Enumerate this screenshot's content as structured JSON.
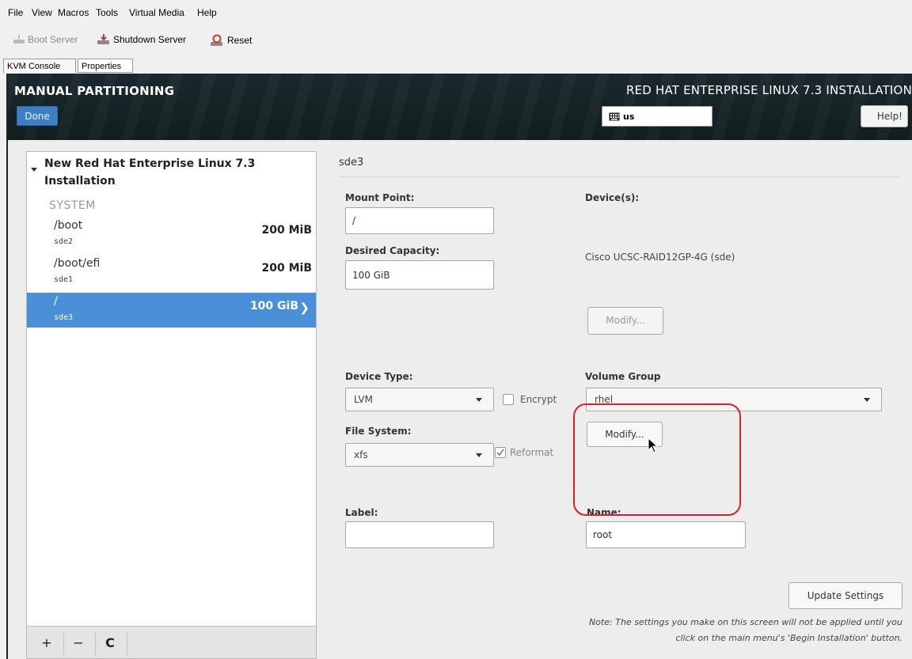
{
  "menubar": {
    "items": [
      "File",
      "View",
      "Macros",
      "Tools",
      "Virtual Media",
      "Help"
    ]
  },
  "toolbar": {
    "boot_server": "Boot Server",
    "shutdown_server": "Shutdown Server",
    "reset": "Reset"
  },
  "tabs": [
    "KVM Console",
    "Properties"
  ],
  "header": {
    "title": "MANUAL PARTITIONING",
    "done_label": "Done",
    "product": "RED HAT ENTERPRISE LINUX 7.3 INSTALLATION",
    "keyboard_layout": "us",
    "help_label": "Help!"
  },
  "left_pane": {
    "install_title": "New Red Hat Enterprise Linux 7.3 Installation",
    "section": "SYSTEM",
    "mounts": [
      {
        "mount": "/boot",
        "device": "sde2",
        "size": "200 MiB"
      },
      {
        "mount": "/boot/efi",
        "device": "sde1",
        "size": "200 MiB"
      },
      {
        "mount": "/",
        "device": "sde3",
        "size": "100 GiB",
        "selected": true
      }
    ],
    "footer": {
      "add": "+",
      "remove": "−",
      "refresh": "C"
    }
  },
  "detail": {
    "device_title": "sde3",
    "mount_point_label": "Mount Point:",
    "mount_point_value": "/",
    "desired_capacity_label": "Desired Capacity:",
    "desired_capacity_value": "100 GiB",
    "devices_label": "Device(s):",
    "device_name": "Cisco UCSC-RAID12GP-4G (sde)",
    "modify_devices_label": "Modify...",
    "device_type_label": "Device Type:",
    "device_type_value": "LVM",
    "encrypt_label": "Encrypt",
    "encrypt_checked": false,
    "volume_group_label": "Volume Group",
    "volume_group_value": "rhel",
    "modify_vg_label": "Modify...",
    "file_system_label": "File System:",
    "file_system_value": "xfs",
    "reformat_label": "Reformat",
    "reformat_checked": true,
    "label_label": "Label:",
    "label_value": "",
    "name_label": "Name:",
    "name_value": "root",
    "update_settings_label": "Update Settings",
    "note": "Note:  The settings you make on this screen will not be applied until you click on the main menu's 'Begin Installation' button."
  },
  "colors": {
    "selected_row": "#4a90d9",
    "done_button": "#3c7fc4",
    "highlight_outline": "#e02020"
  }
}
